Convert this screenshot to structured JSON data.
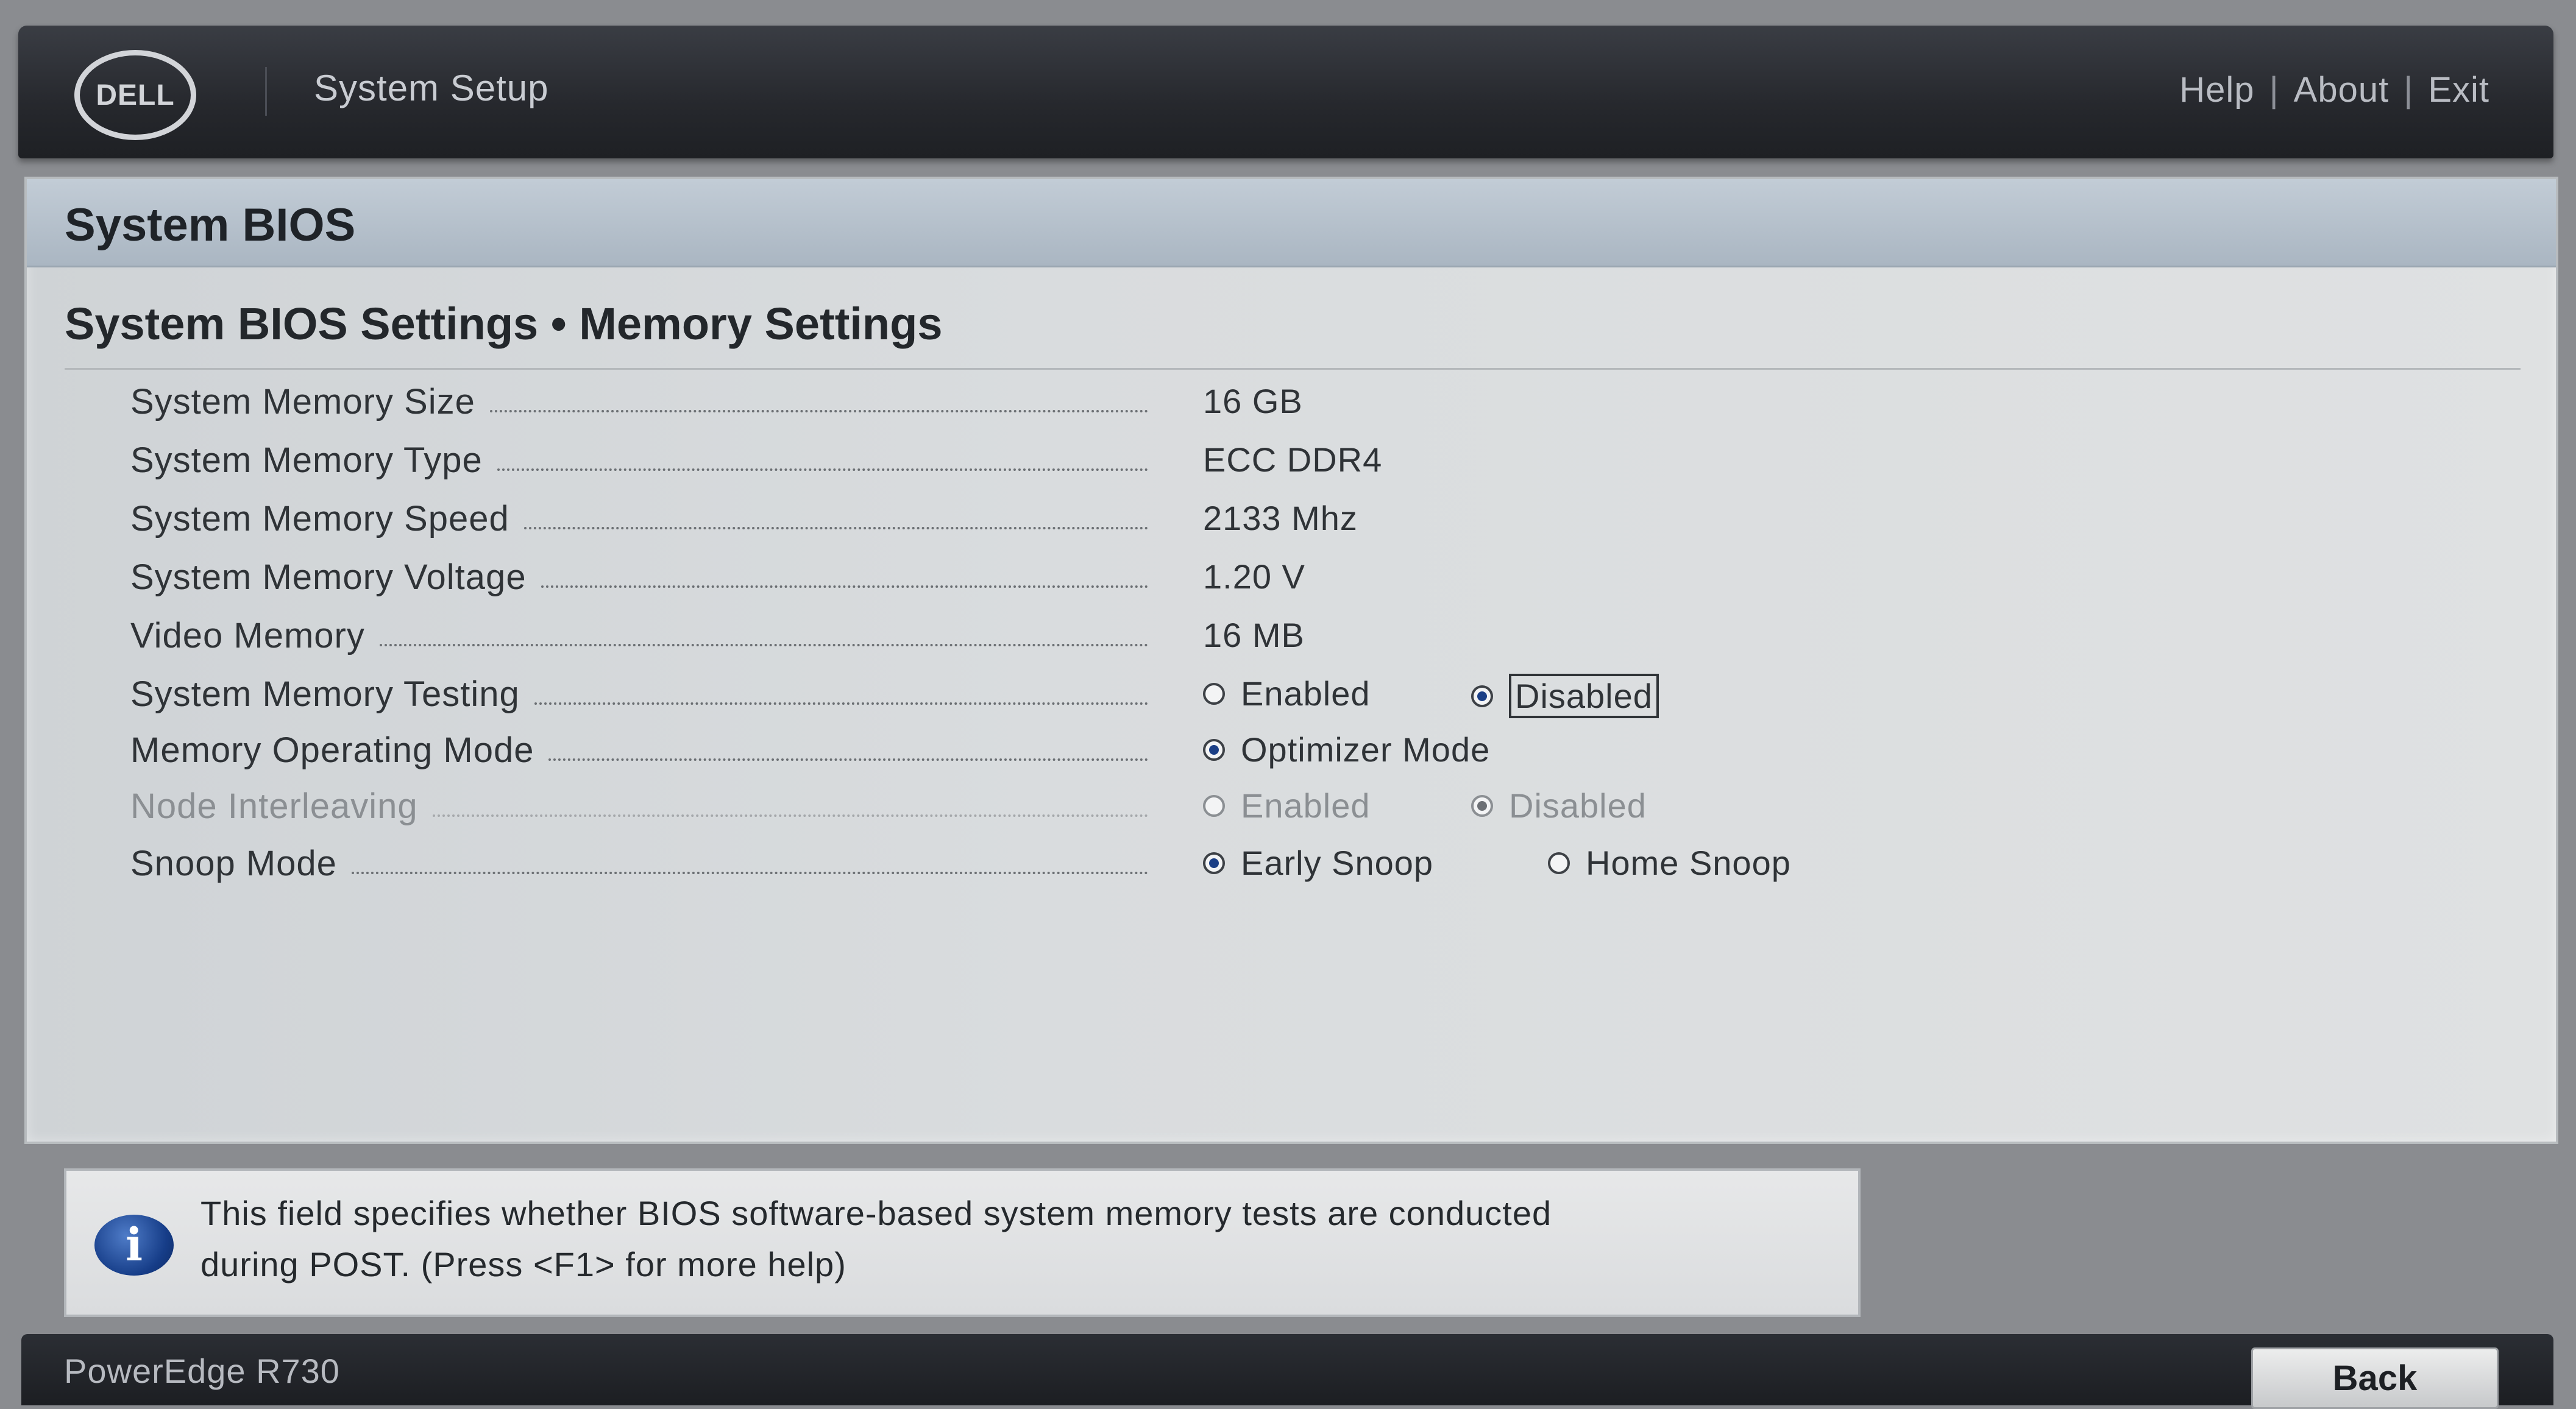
{
  "header": {
    "logo_text": "DELL",
    "title": "System Setup",
    "nav": {
      "help": "Help",
      "about": "About",
      "exit": "Exit",
      "separator": "|"
    }
  },
  "page": {
    "title": "System BIOS",
    "breadcrumb": "System BIOS Settings • Memory Settings"
  },
  "settings": {
    "memory_size": {
      "label": "System Memory Size",
      "value": "16 GB"
    },
    "memory_type": {
      "label": "System Memory Type",
      "value": "ECC DDR4"
    },
    "memory_speed": {
      "label": "System Memory Speed",
      "value": "2133 Mhz"
    },
    "memory_voltage": {
      "label": "System Memory Voltage",
      "value": "1.20 V"
    },
    "video_memory": {
      "label": "Video Memory",
      "value": "16 MB"
    },
    "memory_testing": {
      "label": "System Memory Testing",
      "options": [
        "Enabled",
        "Disabled"
      ],
      "selected": "Disabled"
    },
    "operating_mode": {
      "label": "Memory Operating Mode",
      "options": [
        "Optimizer Mode"
      ],
      "selected": "Optimizer Mode"
    },
    "node_interleaving": {
      "label": "Node Interleaving",
      "options": [
        "Enabled",
        "Disabled"
      ],
      "selected": "Disabled",
      "disabled": true
    },
    "snoop_mode": {
      "label": "Snoop Mode",
      "options": [
        "Early Snoop",
        "Home Snoop"
      ],
      "selected": "Early Snoop"
    }
  },
  "help_box": {
    "icon": "info-icon",
    "line1": "This field specifies whether BIOS software-based system memory tests are conducted",
    "line2": "during POST. (Press <F1> for more help)"
  },
  "footer": {
    "model": "PowerEdge R730",
    "back_label": "Back"
  },
  "colors": {
    "header_bg": "#26282d",
    "panel_bg": "#d9dcde",
    "section_header_bg": "#aab6c2",
    "radio_selected": "#1b3f86"
  }
}
